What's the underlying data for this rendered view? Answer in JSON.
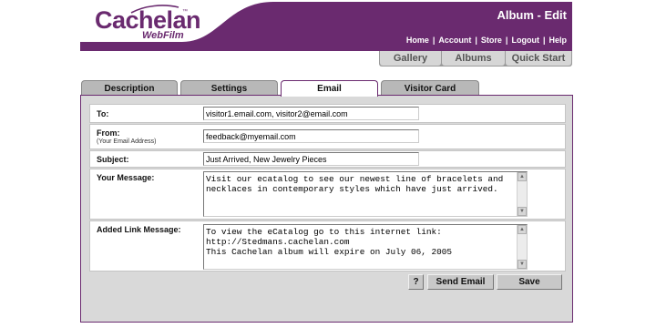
{
  "brand": {
    "name": "Cachelan",
    "tm": "™",
    "product": "WebFilm"
  },
  "page_title": "Album - Edit",
  "top_nav": [
    "Home",
    "Account",
    "Store",
    "Logout",
    "Help"
  ],
  "sub_tabs": [
    "Gallery",
    "Albums",
    "Quick Start"
  ],
  "tabs": [
    {
      "label": "Description",
      "active": false
    },
    {
      "label": "Settings",
      "active": false
    },
    {
      "label": "Email",
      "active": true
    },
    {
      "label": "Visitor Card",
      "active": false
    }
  ],
  "form": {
    "to": {
      "label": "To:",
      "value": "visitor1.email.com, visitor2@email.com"
    },
    "from": {
      "label": "From:",
      "sublabel": "(Your Email Address)",
      "value": "feedback@myemail.com"
    },
    "subject": {
      "label": "Subject:",
      "value": "Just Arrived, New Jewelry Pieces"
    },
    "message": {
      "label": "Your Message:",
      "value": "Visit our ecatalog to see our newest line of bracelets and\nnecklaces in contemporary styles which have just arrived."
    },
    "link_message": {
      "label": "Added Link Message:",
      "value": "To view the eCatalog go to this internet link:\nhttp://Stedmans.cachelan.com\nThis Cachelan album will expire on July 06, 2005"
    }
  },
  "buttons": {
    "help": "?",
    "send": "Send Email",
    "save": "Save"
  },
  "colors": {
    "brand_purple": "#6a2a6f",
    "panel_gray": "#d9d9d9",
    "button_gray": "#c8c8c8"
  }
}
